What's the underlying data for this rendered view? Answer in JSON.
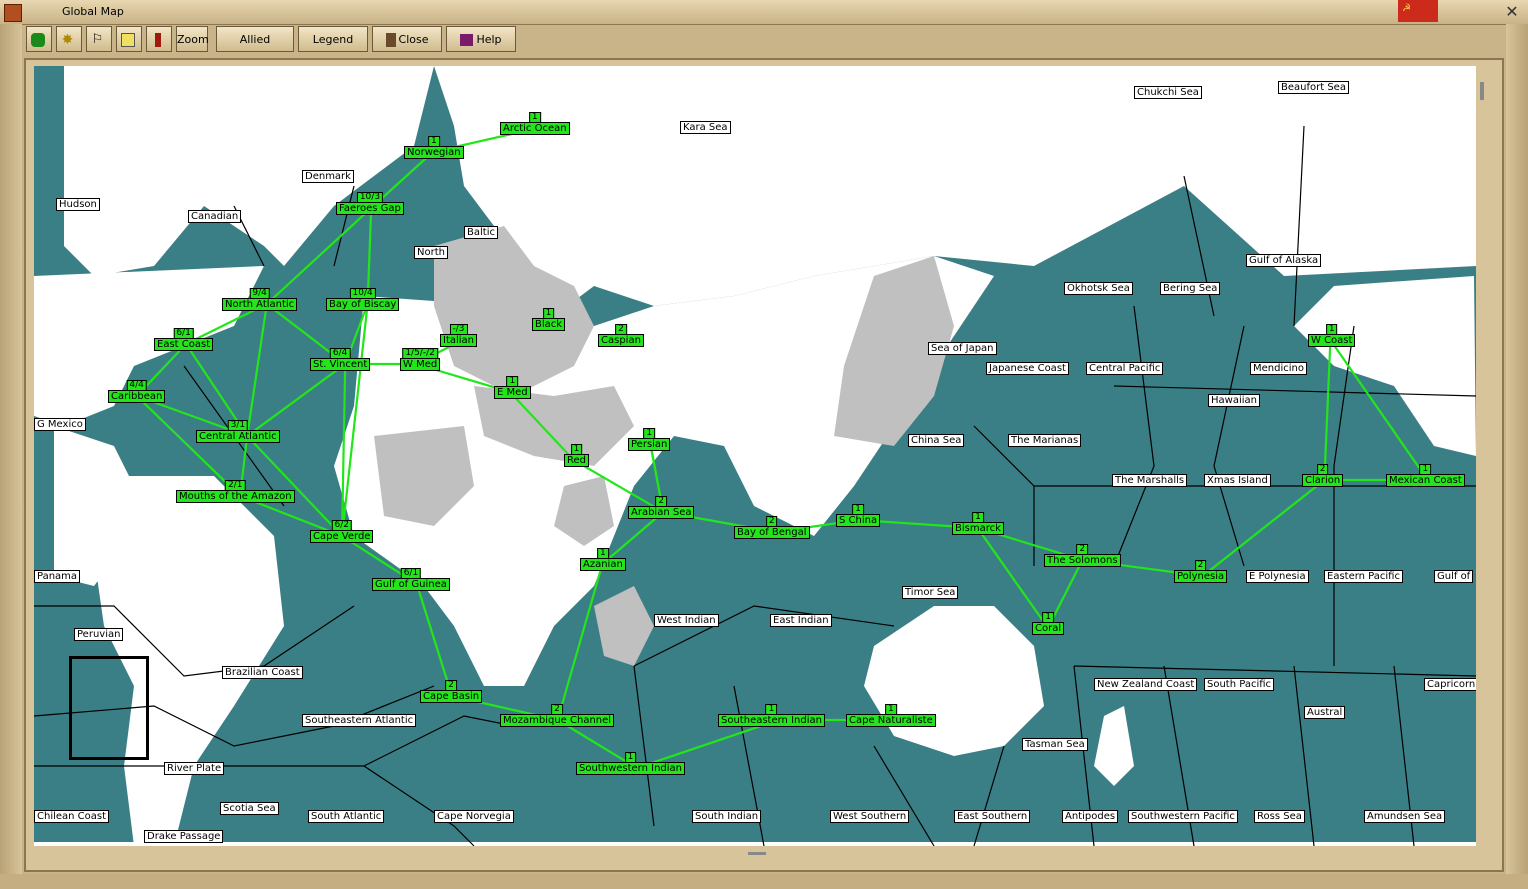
{
  "window": {
    "title": "Global Map"
  },
  "toolbar": {
    "zoom": "Zoom",
    "allied_convoys": "Allied Convoys",
    "legend": "Legend",
    "close": "Close",
    "help": "Help"
  },
  "colors": {
    "ocean": "#3b7f86",
    "land": "#ffffff",
    "occupied": "#c0c0c0",
    "convoy_route": "#22e61a"
  },
  "sea_labels": [
    "Chukchi Sea",
    "Beaufort Sea",
    "Kara Sea",
    "Hudson",
    "Canadian",
    "Denmark",
    "Baltic",
    "North",
    "Gulf of Alaska",
    "Okhotsk Sea",
    "Bering Sea",
    "Sea of Japan",
    "Japanese Coast",
    "Central Pacific",
    "Mendicino",
    "Hawaiian",
    "G Mexico",
    "China Sea",
    "The Marianas",
    "The Marshalls",
    "Xmas Island",
    "Panama",
    "Peruvian",
    "Timor Sea",
    "E Polynesia",
    "Eastern Pacific",
    "Gulf of",
    "West Indian",
    "East Indian",
    "Brazilian Coast",
    "Southeastern Atlantic",
    "New Zealand Coast",
    "South Pacific",
    "Capricorn",
    "Austral",
    "Tasman Sea",
    "River Plate",
    "Scotia Sea",
    "Chilean Coast",
    "South Atlantic",
    "Cape Norvegia",
    "South Indian",
    "West Southern",
    "East Southern",
    "Antipodes",
    "Southwestern Pacific",
    "Ross Sea",
    "Amundsen Sea",
    "Drake Passage"
  ],
  "convoy_nodes": [
    {
      "name": "Arctic Ocean",
      "count": "1"
    },
    {
      "name": "Norwegian",
      "count": "1"
    },
    {
      "name": "Faeroes Gap",
      "count": "10/3"
    },
    {
      "name": "North Atlantic",
      "count": "9/4"
    },
    {
      "name": "Bay of Biscay",
      "count": "10/4"
    },
    {
      "name": "East Coast",
      "count": "6/1"
    },
    {
      "name": "St. Vincent",
      "count": "6/4"
    },
    {
      "name": "W Med",
      "count": "1/5/-/2"
    },
    {
      "name": "Italian",
      "count": "-/3"
    },
    {
      "name": "Black",
      "count": "1"
    },
    {
      "name": "Caspian",
      "count": "2"
    },
    {
      "name": "Caribbean",
      "count": "4/4"
    },
    {
      "name": "Central Atlantic",
      "count": "3/1"
    },
    {
      "name": "E Med",
      "count": "1"
    },
    {
      "name": "Persian",
      "count": "1"
    },
    {
      "name": "Red",
      "count": "1"
    },
    {
      "name": "Mouths of the Amazon",
      "count": "2/1"
    },
    {
      "name": "Arabian Sea",
      "count": "2"
    },
    {
      "name": "Cape Verde",
      "count": "6/2"
    },
    {
      "name": "Bay of Bengal",
      "count": "2"
    },
    {
      "name": "S China",
      "count": "1"
    },
    {
      "name": "Bismarck",
      "count": "1"
    },
    {
      "name": "Azanian",
      "count": "1"
    },
    {
      "name": "Gulf of Guinea",
      "count": "6/1"
    },
    {
      "name": "The Solomons",
      "count": "2"
    },
    {
      "name": "Polynesia",
      "count": "2"
    },
    {
      "name": "Coral",
      "count": "1"
    },
    {
      "name": "W Coast",
      "count": "1"
    },
    {
      "name": "Clarion",
      "count": "2"
    },
    {
      "name": "Mexican Coast",
      "count": "1"
    },
    {
      "name": "Cape Basin",
      "count": "2"
    },
    {
      "name": "Mozambique Channel",
      "count": "2"
    },
    {
      "name": "Southeastern Indian",
      "count": "1"
    },
    {
      "name": "Cape Naturaliste",
      "count": "1"
    },
    {
      "name": "Southwestern Indian",
      "count": "1"
    }
  ]
}
